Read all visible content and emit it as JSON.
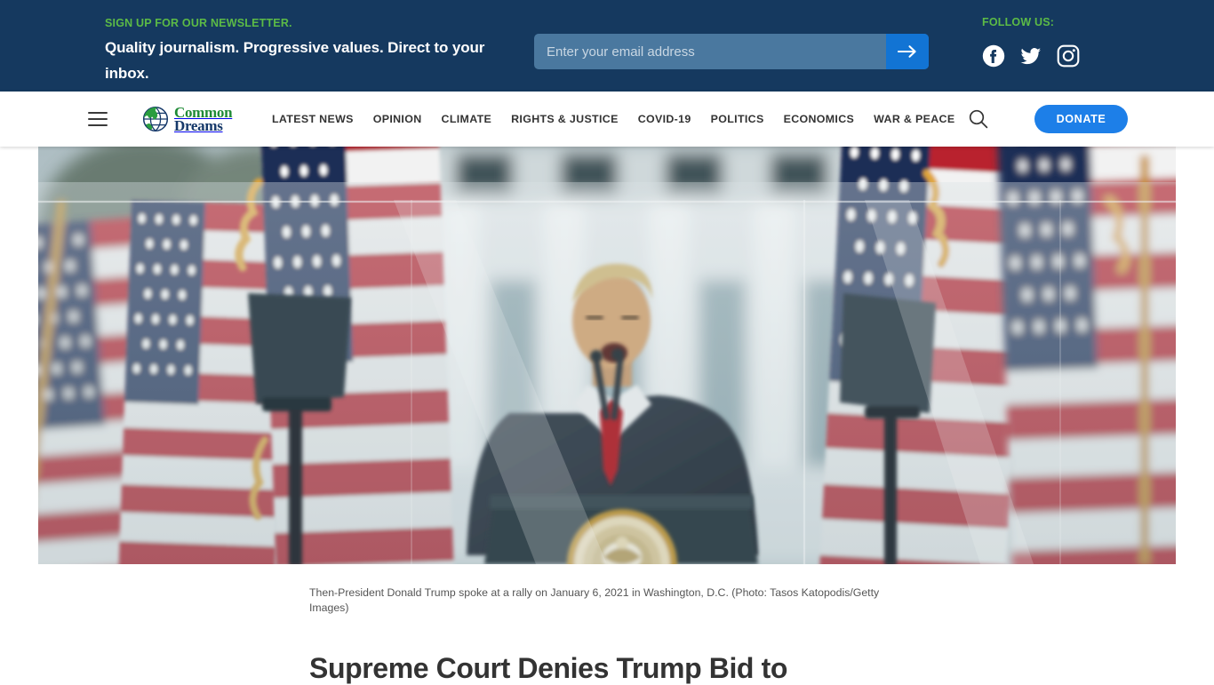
{
  "newsletter": {
    "kicker": "SIGN UP FOR OUR NEWSLETTER.",
    "headline": "Quality journalism. Progressive values. Direct to your inbox.",
    "email_placeholder": "Enter your email address",
    "email_value": "",
    "submit_icon": "arrow-right-icon",
    "bg_color": "#15395f",
    "accent_green": "#5cbb46",
    "submit_blue": "#1274d4"
  },
  "follow": {
    "label": "FOLLOW US:",
    "socials": [
      {
        "name": "facebook-icon",
        "label": "Facebook"
      },
      {
        "name": "twitter-icon",
        "label": "Twitter"
      },
      {
        "name": "instagram-icon",
        "label": "Instagram"
      }
    ]
  },
  "nav": {
    "menu_icon": "hamburger-menu-icon",
    "logo": {
      "line1": "Common",
      "line2": "Dreams",
      "mark": "globe-icon",
      "green": "#1f8a36",
      "navy": "#16396a"
    },
    "links": [
      "LATEST NEWS",
      "OPINION",
      "CLIMATE",
      "RIGHTS & JUSTICE",
      "COVID-19",
      "POLITICS",
      "ECONOMICS",
      "WAR & PEACE"
    ],
    "search_icon": "search-icon",
    "donate_label": "DONATE",
    "donate_color": "#1d7fe8"
  },
  "article": {
    "hero_alt": "Then-President Donald Trump speaking behind a podium with the presidential seal, American flags on both sides and the White House blurred in the background",
    "caption": "Then-President Donald Trump spoke at a rally on January 6, 2021 in Washington, D.C. (Photo: Tasos Katopodis/Getty Images)",
    "headline": "Supreme Court Denies Trump Bid to"
  }
}
